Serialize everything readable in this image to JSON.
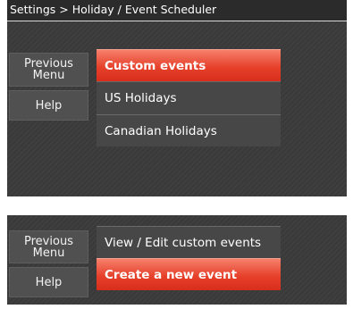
{
  "panel_top": {
    "breadcrumb": "Settings > Holiday / Event Scheduler",
    "side_buttons": {
      "previous_menu": "Previous\nMenu",
      "help": "Help"
    },
    "menu_items": [
      {
        "label": "Custom events",
        "selected": true
      },
      {
        "label": "US Holidays",
        "selected": false
      },
      {
        "label": "Canadian Holidays",
        "selected": false
      }
    ]
  },
  "panel_bottom": {
    "side_buttons": {
      "previous_menu": "Previous\nMenu",
      "help": "Help"
    },
    "menu_items": [
      {
        "label": "View / Edit custom events",
        "selected": false
      },
      {
        "label": "Create a new event",
        "selected": true
      }
    ]
  },
  "colors": {
    "selected_highlight": "#e6412b",
    "screen_background": "#3a3a3a"
  }
}
